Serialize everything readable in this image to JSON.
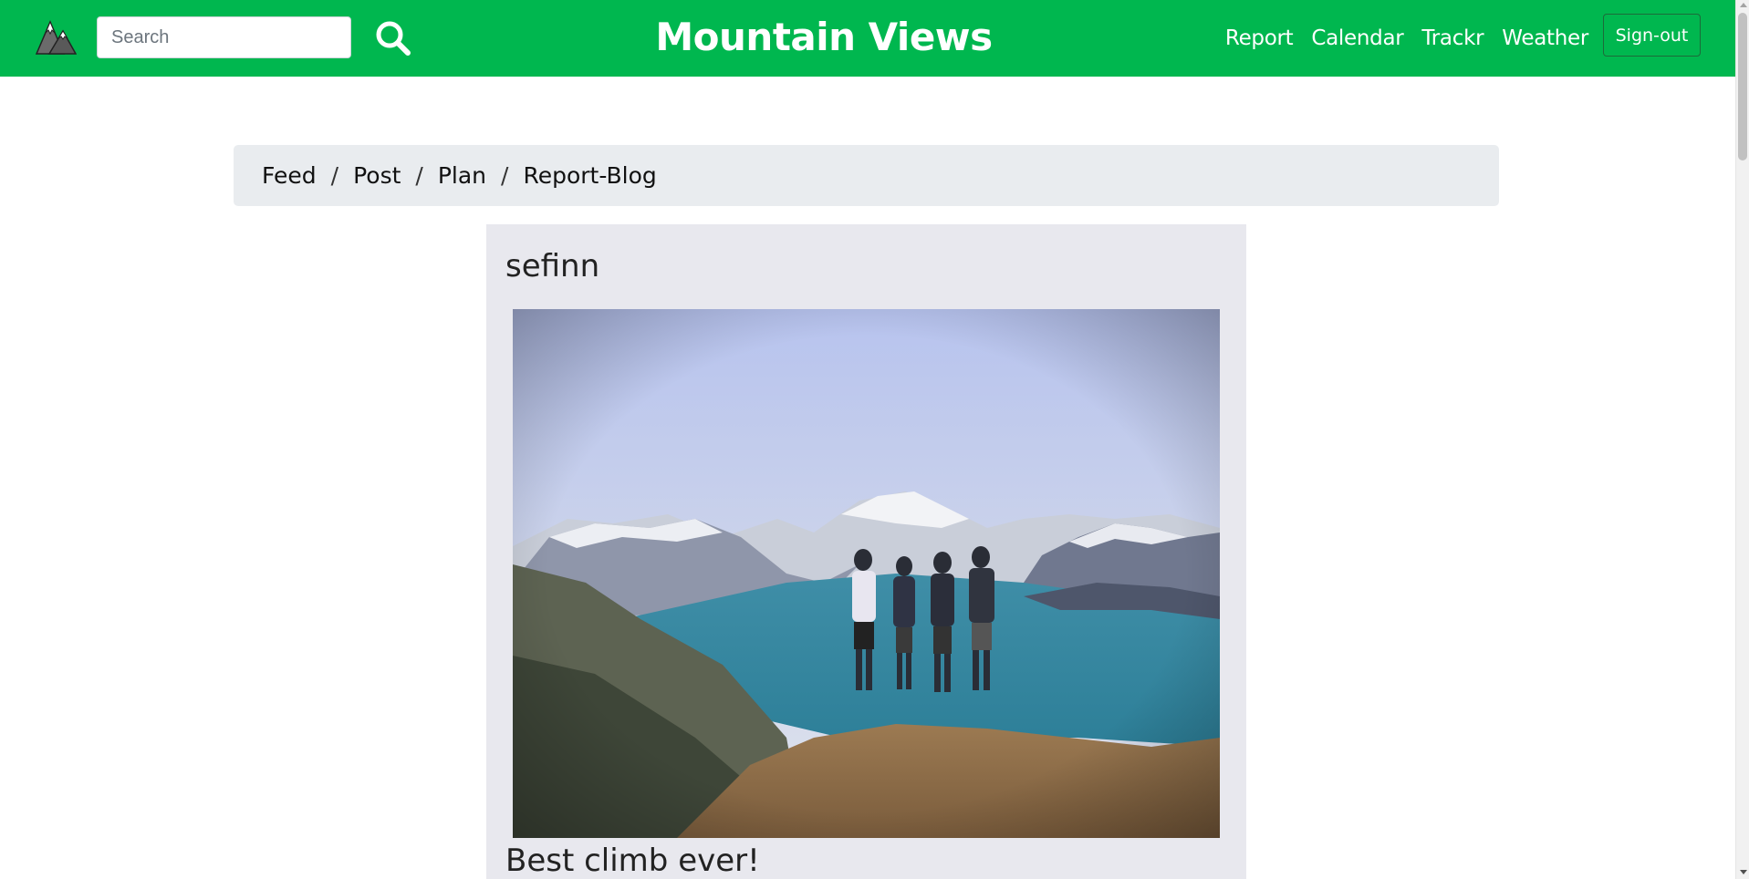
{
  "nav": {
    "logo_icon": "mountain-logo-icon",
    "search_placeholder": "Search",
    "search_value": "",
    "search_icon": "search-icon",
    "brand": "Mountain Views",
    "links": [
      "Report",
      "Calendar",
      "Trackr",
      "Weather"
    ],
    "signout_label": "Sign-out"
  },
  "breadcrumb": {
    "items": [
      "Feed",
      "Post",
      "Plan",
      "Report-Blog"
    ],
    "separator": "/"
  },
  "post": {
    "author": "sefinn",
    "photo_icon": "mountain-lake-photo",
    "caption": "Best climb ever!"
  },
  "colors": {
    "navbar": "#00b74f",
    "breadcrumb_bg": "#e9ecef",
    "card_bg": "#e8e8ee"
  }
}
